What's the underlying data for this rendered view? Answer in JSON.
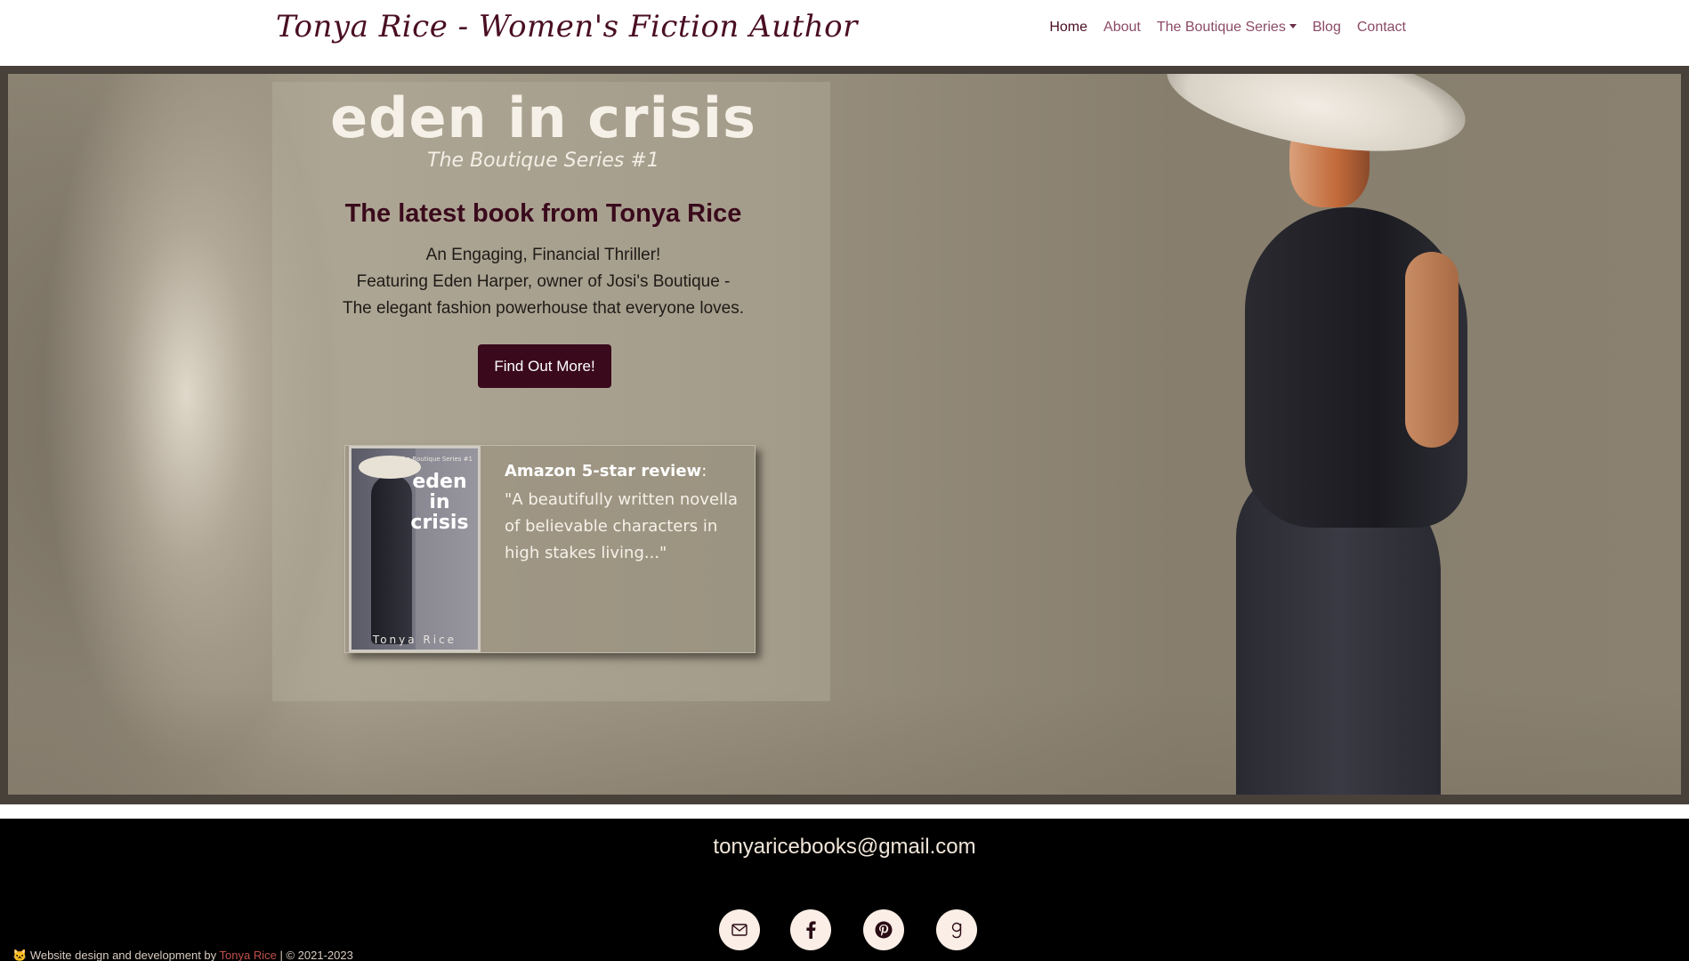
{
  "header": {
    "brand": "Tonya Rice - Women's Fiction Author",
    "nav": [
      {
        "label": "Home",
        "active": true
      },
      {
        "label": "About"
      },
      {
        "label": "The Boutique Series",
        "dropdown": true
      },
      {
        "label": "Blog"
      },
      {
        "label": "Contact"
      }
    ]
  },
  "hero": {
    "title": "eden in crisis",
    "series": "The Boutique Series #1",
    "latest": "The latest book from Tonya Rice",
    "desc_line1": "An Engaging, Financial Thriller!",
    "desc_line2": "Featuring Eden Harper, owner of Josi's Boutique -",
    "desc_line3": "The elegant fashion powerhouse that everyone loves.",
    "cta_label": "Find Out More!",
    "review": {
      "source": "Amazon 5-star review",
      "quote": "\"A beautifully written novella of believable characters in high stakes living...\"",
      "cover": {
        "series": "The Boutique Series #1",
        "title_line1": "eden",
        "title_line2": "in",
        "title_line3": "crisis",
        "author": "Tonya Rice"
      }
    }
  },
  "footer": {
    "email": "tonyaricebooks@gmail.com",
    "social_icons": [
      "envelope-icon",
      "facebook-icon",
      "pinterest-icon",
      "goodreads-icon"
    ],
    "credit_prefix": "Website design and development by",
    "credit_link": "Tonya Rice",
    "credit_suffix": "| © 2021-2023"
  },
  "colors": {
    "brand": "#4a0e24",
    "nav_link": "#8b4a66",
    "cta_bg": "#3a0a1c",
    "footer_bg": "#000000"
  }
}
